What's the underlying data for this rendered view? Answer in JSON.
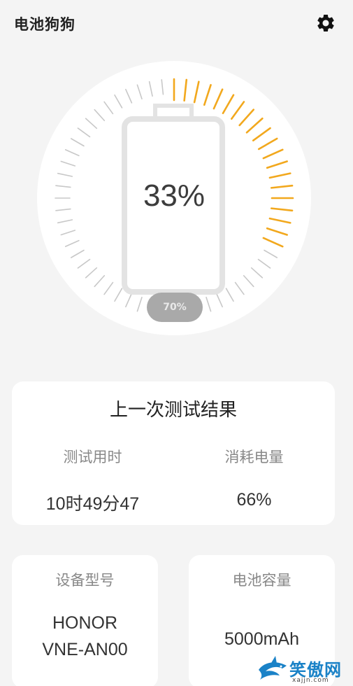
{
  "app": {
    "title": "电池狗狗"
  },
  "battery": {
    "percent_label": "33%",
    "level": 33,
    "target_label": "70%"
  },
  "colors": {
    "accent": "#f2a81d",
    "tick_inactive": "#c8c8c8",
    "battery_outline": "#e3e3e3"
  },
  "result": {
    "title": "上一次测试结果",
    "stats": [
      {
        "label": "测试用时",
        "value": "10时49分47"
      },
      {
        "label": "消耗电量",
        "value": "66%"
      }
    ]
  },
  "device": {
    "label": "设备型号",
    "model_line1": "HONOR",
    "model_line2": "VNE-AN00"
  },
  "capacity": {
    "label": "电池容量",
    "value": "5000mAh"
  },
  "watermark": {
    "text": "笑傲网",
    "url": "xajjn.com"
  },
  "icons": {
    "settings": "gear-icon",
    "watermark_logo": "shark-logo"
  }
}
